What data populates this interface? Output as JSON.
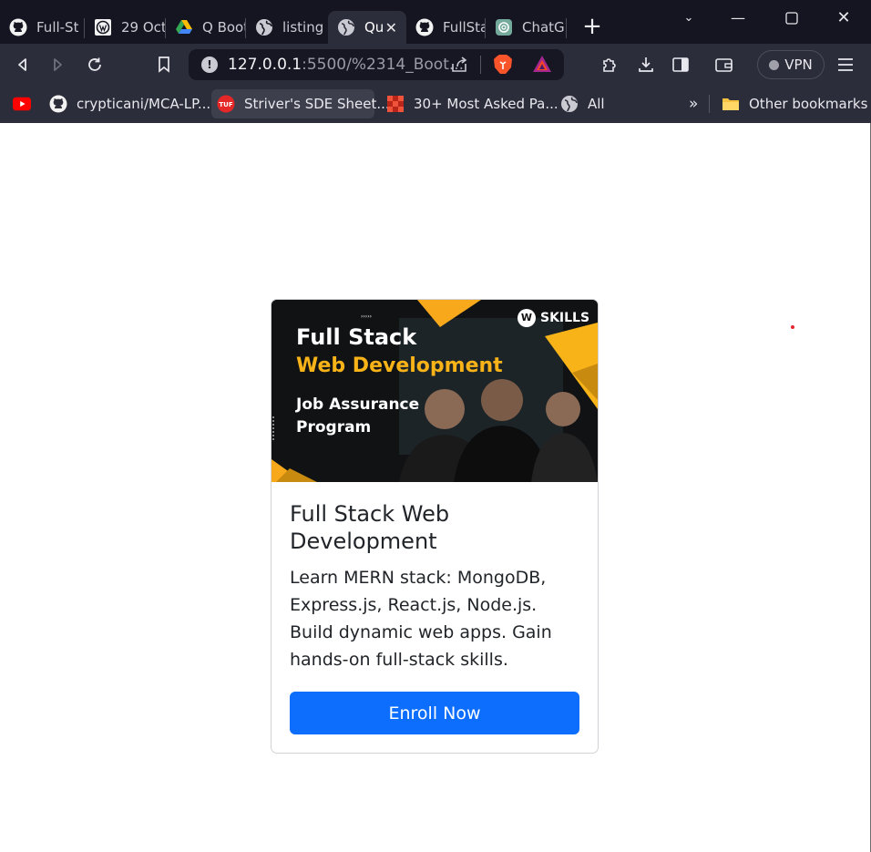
{
  "browser": {
    "tabs": [
      {
        "title": "Full-St",
        "icon": "github-icon"
      },
      {
        "title": "29 Oct",
        "icon": "wordpress-icon"
      },
      {
        "title": "Q Boot",
        "icon": "google-drive-icon"
      },
      {
        "title": "listing",
        "icon": "globe-icon"
      },
      {
        "title": "Qu",
        "icon": "globe-icon",
        "active": true
      },
      {
        "title": "FullSta",
        "icon": "github-icon"
      },
      {
        "title": "ChatG",
        "icon": "chatgpt-icon"
      }
    ],
    "address": {
      "host": "127.0.0.1",
      "rest": ":5500/%2314_Boot..."
    },
    "vpn_label": "VPN",
    "bookmarks": [
      {
        "label": "",
        "icon": "youtube-icon"
      },
      {
        "label": "crypticani/MCA-LP...",
        "icon": "github-icon"
      },
      {
        "label": "Striver's SDE Sheet...",
        "icon": "tuf-icon"
      },
      {
        "label": "30+ Most Asked Pa...",
        "icon": "pattern-icon"
      },
      {
        "label": "All",
        "icon": "globe-icon"
      }
    ],
    "overflow_label": "»",
    "other_bookmarks": "Other bookmarks"
  },
  "card": {
    "image": {
      "brand": "SKILLS",
      "line1": "Full Stack",
      "line2": "Web Development",
      "line3": "Job Assurance Program"
    },
    "title": "Full Stack Web Development",
    "text": "Learn MERN stack: MongoDB, Express.js, React.js, Node.js. Build dynamic web apps. Gain hands-on full-stack skills.",
    "button": "Enroll Now"
  },
  "colors": {
    "primary": "#0d6efd",
    "banner_accent": "#f7b318",
    "browser_bg": "#2c2d3a"
  }
}
